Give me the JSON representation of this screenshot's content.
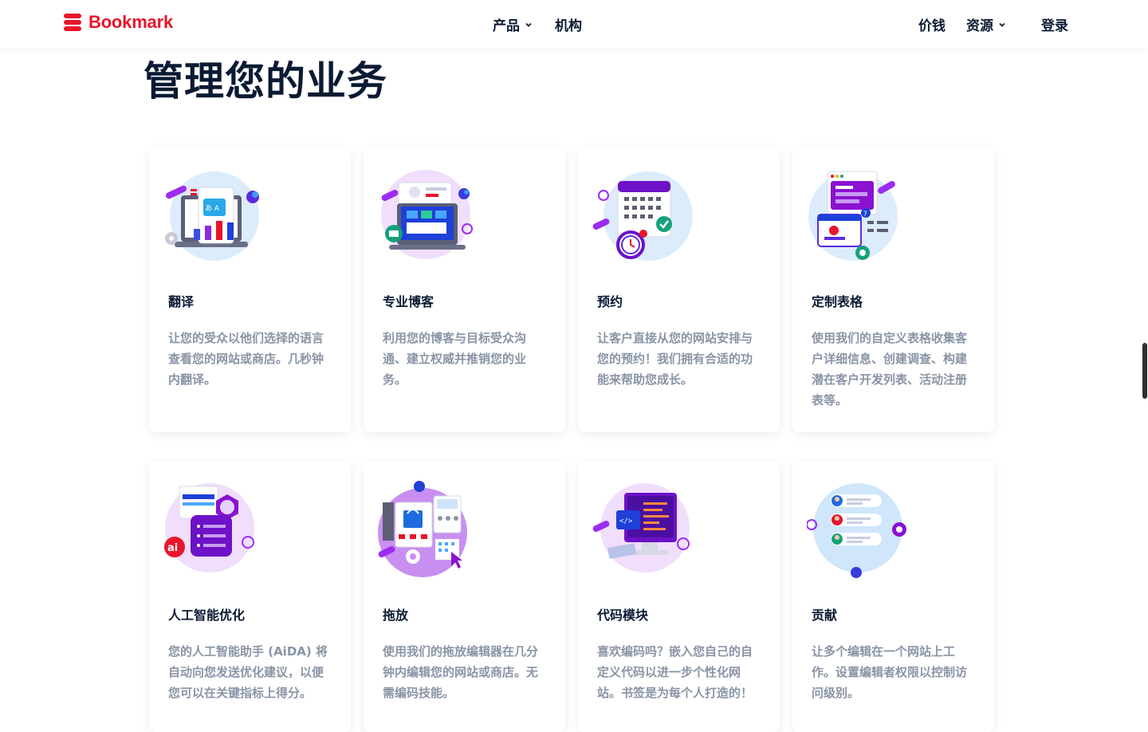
{
  "brand": {
    "name": "Bookmark",
    "accent": "#e8152b"
  },
  "nav": {
    "products": "产品",
    "agencies": "机构",
    "pricing": "价钱",
    "resources": "资源",
    "login": "登录"
  },
  "section": {
    "title": "管理您的业务"
  },
  "features": [
    {
      "title": "翻译",
      "desc": "让您的受众以他们选择的语言查看您的网站或商店。几秒钟内翻译。",
      "icon": "translate-illustration-icon"
    },
    {
      "title": "专业博客",
      "desc": "利用您的博客与目标受众沟通、建立权威并推销您的业务。",
      "icon": "blog-illustration-icon"
    },
    {
      "title": "预约",
      "desc": "让客户直接从您的网站安排与您的预约！我们拥有合适的功能来帮助您成长。",
      "icon": "calendar-illustration-icon"
    },
    {
      "title": "定制表格",
      "desc": "使用我们的自定义表格收集客户详细信息、创建调查、构建潜在客户开发列表、活动注册表等。",
      "icon": "forms-illustration-icon"
    },
    {
      "title": "人工智能优化",
      "desc": "您的人工智能助手 (AiDA) 将自动向您发送优化建议，以便您可以在关键指标上得分。",
      "icon": "ai-illustration-icon"
    },
    {
      "title": "拖放",
      "desc": "使用我们的拖放编辑器在几分钟内编辑您的网站或商店。无需编码技能。",
      "icon": "drag-drop-illustration-icon"
    },
    {
      "title": "代码模块",
      "desc": "喜欢编码吗？嵌入您自己的自定义代码以进一步个性化网站。书签是为每个人打造的！",
      "icon": "code-illustration-icon"
    },
    {
      "title": "贡献",
      "desc": "让多个编辑在一个网站上工作。设置编辑者权限以控制访问级别。",
      "icon": "contributors-illustration-icon"
    }
  ]
}
